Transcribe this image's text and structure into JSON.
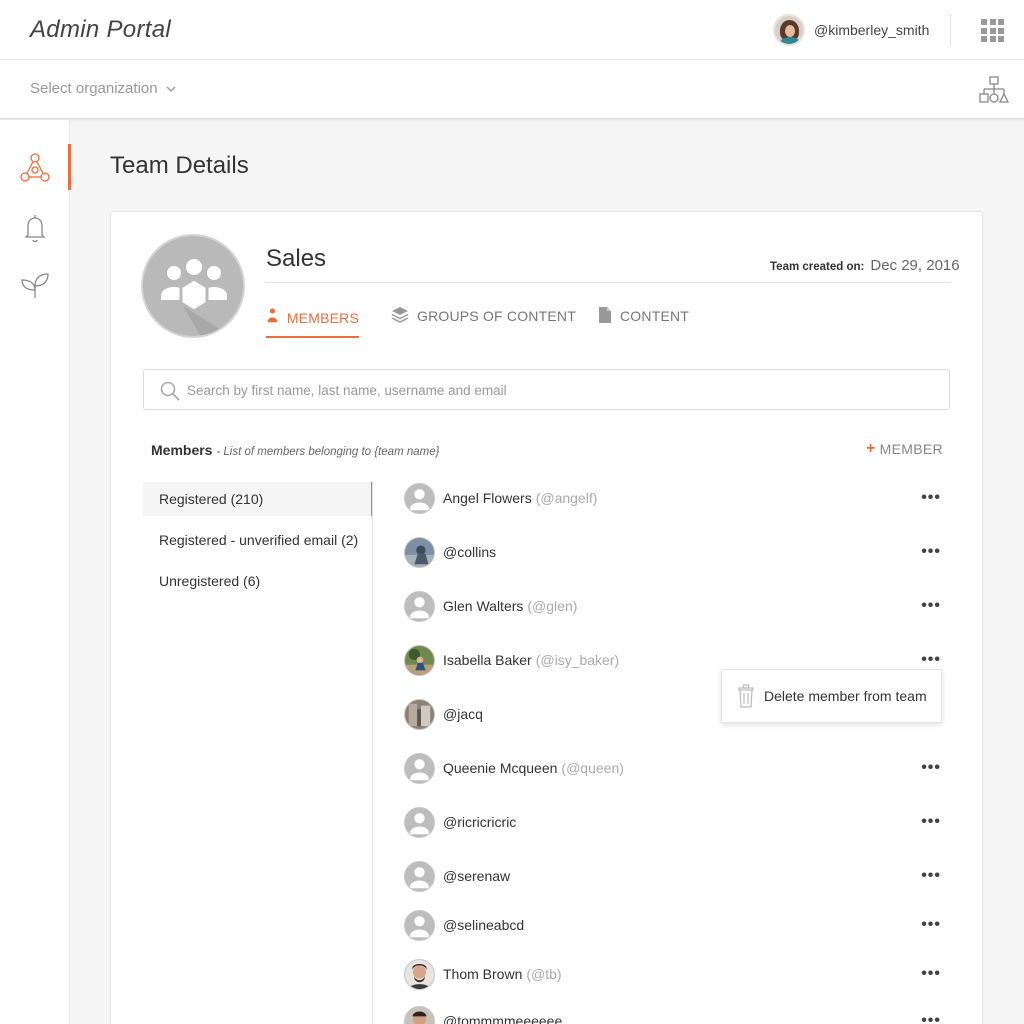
{
  "header": {
    "app_title": "Admin Portal",
    "username": "@kimberley_smith",
    "apps_icon": "apps-grid-icon",
    "org_chart_icon": "org-chart-icon"
  },
  "org_bar": {
    "select_label": "Select organization"
  },
  "sidebar": {
    "items": [
      {
        "icon": "teams-icon",
        "active": true
      },
      {
        "icon": "bell-icon",
        "active": false
      },
      {
        "icon": "sprout-icon",
        "active": false
      }
    ]
  },
  "page": {
    "title": "Team Details"
  },
  "team": {
    "name": "Sales",
    "created_label": "Team created on:",
    "created_value": "Dec 29, 2016"
  },
  "tabs": [
    {
      "label": "MEMBERS",
      "active": true,
      "icon": "person-icon"
    },
    {
      "label": "GROUPS OF CONTENT",
      "active": false,
      "icon": "layers-icon"
    },
    {
      "label": "CONTENT",
      "active": false,
      "icon": "document-icon"
    }
  ],
  "search": {
    "placeholder": "Search by first name, last name, username and email"
  },
  "members_section": {
    "title": "Members",
    "subtitle": "- List of members belonging to {team name}",
    "add_label": "MEMBER"
  },
  "filters": [
    {
      "label": "Registered (210)",
      "active": true
    },
    {
      "label": "Registered - unverified email (2)",
      "active": false
    },
    {
      "label": "Unregistered (6)",
      "active": false
    }
  ],
  "members": [
    {
      "name": "Angel Flowers",
      "handle": "(@angelf)",
      "avatar": "placeholder"
    },
    {
      "name": "@collins",
      "handle": "",
      "avatar": "photo"
    },
    {
      "name": "Glen Walters",
      "handle": "(@glen)",
      "avatar": "placeholder"
    },
    {
      "name": "Isabella Baker",
      "handle": "(@isy_baker)",
      "avatar": "photo"
    },
    {
      "name": "@jacq",
      "handle": "",
      "avatar": "photo"
    },
    {
      "name": "Queenie Mcqueen",
      "handle": "(@queen)",
      "avatar": "placeholder"
    },
    {
      "name": "@ricricricric",
      "handle": "",
      "avatar": "placeholder"
    },
    {
      "name": "@serenaw",
      "handle": "",
      "avatar": "placeholder"
    },
    {
      "name": "@selineabcd",
      "handle": "",
      "avatar": "placeholder"
    },
    {
      "name": "Thom Brown",
      "handle": "(@tb)",
      "avatar": "photo"
    },
    {
      "name": "@tommmmeeeeee",
      "handle": "",
      "avatar": "photo"
    }
  ],
  "more_label": "•••",
  "context_menu": {
    "delete_label": "Delete member from team"
  },
  "colors": {
    "accent": "#f26b3a"
  }
}
